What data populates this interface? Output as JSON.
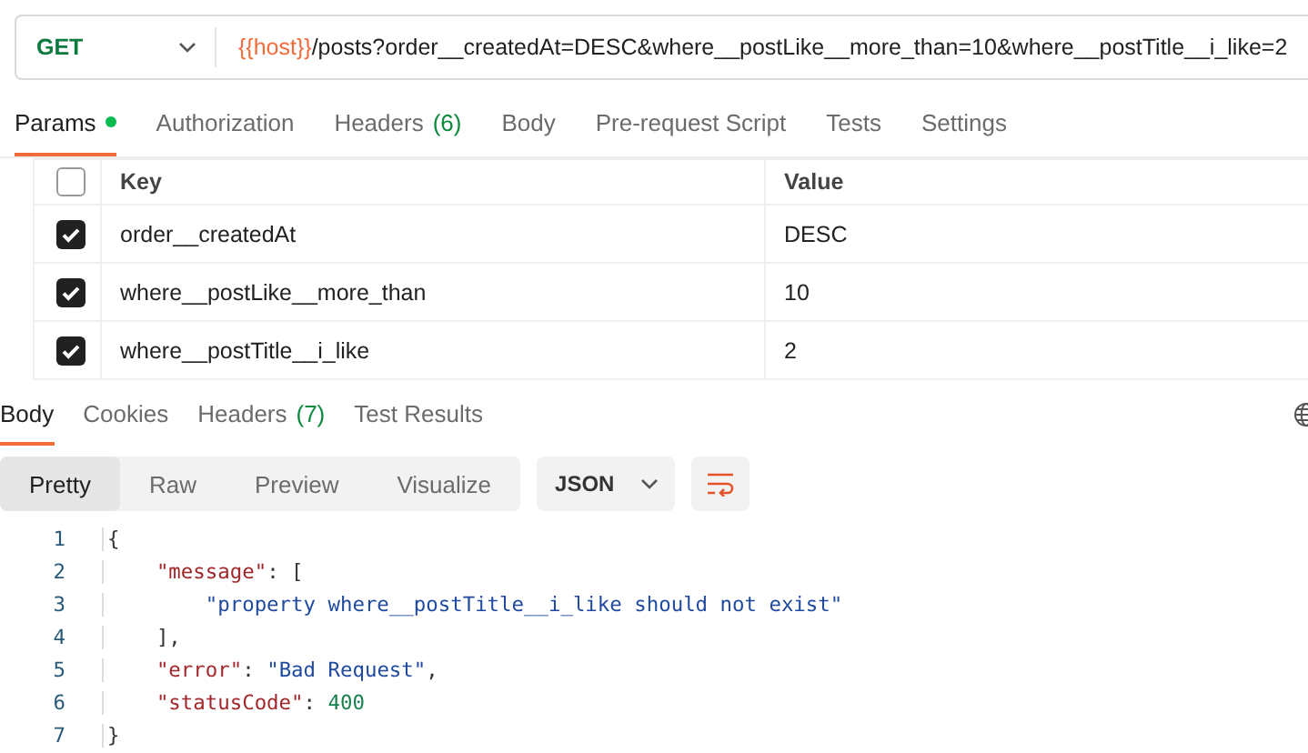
{
  "request": {
    "method": "GET",
    "url_variable": "{{host}}",
    "url_path": "/posts?order__createdAt=DESC&where__postLike__more_than=10&where__postTitle__i_like=2"
  },
  "request_tabs": [
    {
      "label": "Params",
      "indicator": true,
      "selected": true
    },
    {
      "label": "Authorization",
      "indicator": false,
      "selected": false
    },
    {
      "label": "Headers",
      "count": "(6)",
      "indicator": false,
      "selected": false
    },
    {
      "label": "Body",
      "indicator": false,
      "selected": false
    },
    {
      "label": "Pre-request Script",
      "indicator": false,
      "selected": false
    },
    {
      "label": "Tests",
      "indicator": false,
      "selected": false
    },
    {
      "label": "Settings",
      "indicator": false,
      "selected": false
    }
  ],
  "params": {
    "columns": [
      "Key",
      "Value"
    ],
    "all_checked": false,
    "rows": [
      {
        "checked": true,
        "key": "order__createdAt",
        "value": "DESC"
      },
      {
        "checked": true,
        "key": "where__postLike__more_than",
        "value": "10"
      },
      {
        "checked": true,
        "key": "where__postTitle__i_like",
        "value": "2"
      }
    ]
  },
  "response_tabs": [
    {
      "label": "Body",
      "selected": true
    },
    {
      "label": "Cookies",
      "selected": false
    },
    {
      "label": "Headers",
      "count": "(7)",
      "selected": false
    },
    {
      "label": "Test Results",
      "selected": false
    }
  ],
  "view_modes": [
    {
      "label": "Pretty",
      "selected": true
    },
    {
      "label": "Raw",
      "selected": false
    },
    {
      "label": "Preview",
      "selected": false
    },
    {
      "label": "Visualize",
      "selected": false
    }
  ],
  "format": "JSON",
  "code_lines": [
    {
      "number": "1",
      "tokens": [
        {
          "kind": "punct",
          "text": "{"
        }
      ]
    },
    {
      "number": "2",
      "tokens": [
        {
          "kind": "key",
          "text": "    \"message\""
        },
        {
          "kind": "punct",
          "text": ": ["
        }
      ]
    },
    {
      "number": "3",
      "tokens": [
        {
          "kind": "string",
          "text": "        \"property where__postTitle__i_like should not exist\""
        }
      ]
    },
    {
      "number": "4",
      "tokens": [
        {
          "kind": "punct",
          "text": "    ],"
        }
      ]
    },
    {
      "number": "5",
      "tokens": [
        {
          "kind": "key",
          "text": "    \"error\""
        },
        {
          "kind": "punct",
          "text": ": "
        },
        {
          "kind": "string",
          "text": "\"Bad Request\""
        },
        {
          "kind": "punct",
          "text": ","
        }
      ]
    },
    {
      "number": "6",
      "tokens": [
        {
          "kind": "key",
          "text": "    \"statusCode\""
        },
        {
          "kind": "punct",
          "text": ": "
        },
        {
          "kind": "number",
          "text": "400"
        }
      ]
    },
    {
      "number": "7",
      "tokens": [
        {
          "kind": "punct",
          "text": "}"
        }
      ]
    }
  ]
}
